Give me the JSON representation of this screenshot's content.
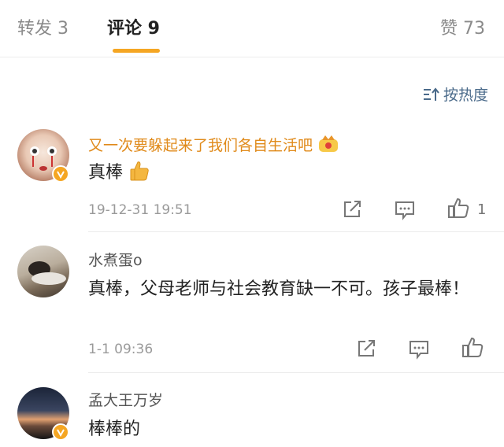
{
  "tabs": {
    "repost": "转发 3",
    "comments": "评论 9",
    "likes": "赞 73"
  },
  "sort": {
    "label": "按热度"
  },
  "comments": [
    {
      "user": "又一次要躲起来了我们各自生活吧",
      "text": "真棒",
      "time": "19-12-31 19:51",
      "likes": "1"
    },
    {
      "user": "水煮蛋o",
      "text": "真棒，父母老师与社会教育缺一不可。孩子最棒！",
      "time": "1-1 09:36",
      "likes": ""
    },
    {
      "user": "孟大王万岁",
      "text": "棒棒的"
    }
  ],
  "colors": {
    "accent": "#f5a623",
    "vip_name": "#e08a1a",
    "link": "#4a6a8a"
  }
}
